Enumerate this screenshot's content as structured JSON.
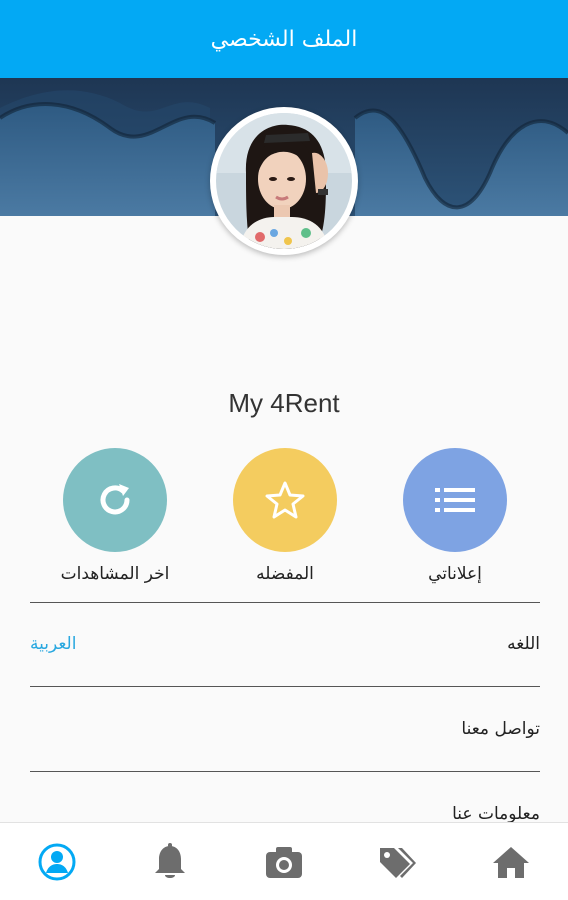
{
  "header": {
    "title": "الملف الشخصي"
  },
  "profile": {
    "brand_name": "My 4Rent"
  },
  "actions": [
    {
      "label": "اخر المشاهدات",
      "icon": "refresh-icon",
      "color": "#7fbfc3"
    },
    {
      "label": "المفضله",
      "icon": "star-icon",
      "color": "#f4cc5f"
    },
    {
      "label": "إعلاناتي",
      "icon": "list-icon",
      "color": "#7ea3e3"
    }
  ],
  "settings": {
    "language_label": "اللغه",
    "language_value": "العربية",
    "contact_label": "تواصل معنا",
    "about_label": "معلومات عنا"
  },
  "bottom_nav": [
    {
      "name": "profile",
      "icon": "user-icon",
      "active": true
    },
    {
      "name": "notifications",
      "icon": "bell-icon",
      "active": false
    },
    {
      "name": "camera",
      "icon": "camera-icon",
      "active": false
    },
    {
      "name": "tags",
      "icon": "tags-icon",
      "active": false
    },
    {
      "name": "home",
      "icon": "home-icon",
      "active": false
    }
  ],
  "colors": {
    "primary": "#03a9f4",
    "link": "#29a8e0",
    "icon_inactive": "#6d6d6d"
  }
}
